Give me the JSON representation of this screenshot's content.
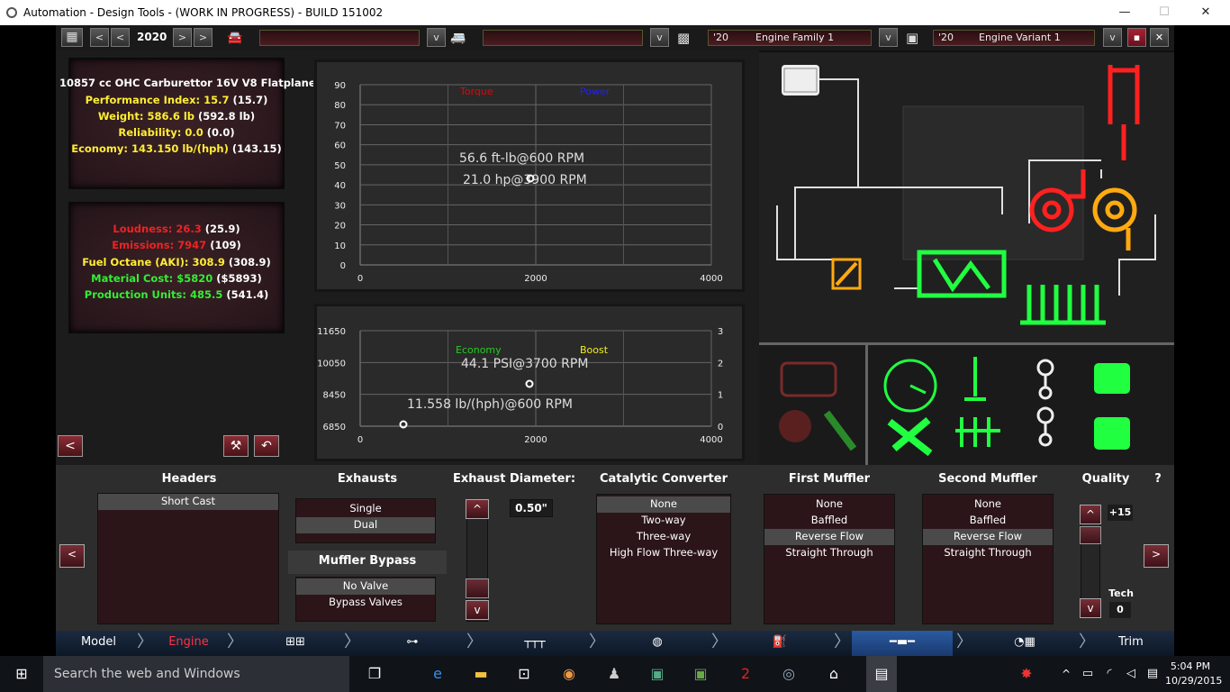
{
  "window": {
    "title": "Automation - Design Tools - (WORK IN PROGRESS) - BUILD 151002",
    "minimize": "—",
    "maximize": "☐",
    "close": "✕"
  },
  "toolbar": {
    "year": "2020",
    "prev": "<",
    "prev2": "<",
    "next": ">",
    "next2": ">",
    "field1": "",
    "field2": "",
    "family_year": "'20",
    "family": "Engine Family 1",
    "variant_year": "'20",
    "variant": "Engine Variant 1",
    "dropdown": "v"
  },
  "stats": {
    "engine": "10857 cc OHC Carburettor 16V V8 Flatplane",
    "perf_label": "Performance Index: 15.7",
    "perf_ref": "(15.7)",
    "weight_label": "Weight: 586.6 lb",
    "weight_ref": "(592.8 lb)",
    "rel_label": "Reliability: 0.0",
    "rel_ref": "(0.0)",
    "eco_label": "Economy: 143.150 lb/(hph)",
    "eco_ref": "(143.15)",
    "loud_label": "Loudness: 26.3",
    "loud_ref": "(25.9)",
    "emis_label": "Emissions: 7947",
    "emis_ref": "(109)",
    "oct_label": "Fuel Octane (AKI): 308.9",
    "oct_ref": "(308.9)",
    "mat_label": "Material Cost: $5820",
    "mat_ref": "($5893)",
    "prod_label": "Production Units: 485.5",
    "prod_ref": "(541.4)"
  },
  "chart_data": [
    {
      "type": "line",
      "legend": [
        "Torque",
        "Power"
      ],
      "colors": [
        "#ee0000",
        "#2222ee"
      ],
      "yticks": [
        "90",
        "80",
        "70",
        "60",
        "50",
        "40",
        "30",
        "20",
        "10",
        "0"
      ],
      "xticks": [
        "0",
        "2000",
        "4000"
      ],
      "ylim": [
        0,
        90
      ],
      "xlim": [
        0,
        4000
      ],
      "series": [
        {
          "name": "Torque",
          "values": []
        },
        {
          "name": "Power",
          "values": []
        }
      ],
      "annotations": [
        "56.6 ft-lb@600 RPM",
        "21.0 hp@3900 RPM"
      ]
    },
    {
      "type": "line",
      "legend": [
        "Economy",
        "Boost"
      ],
      "colors": [
        "#22cc22",
        "#eeee22"
      ],
      "yticks_left": [
        "11650",
        "10050",
        "8450",
        "6850"
      ],
      "yticks_right": [
        "3",
        "2",
        "1",
        "0"
      ],
      "xticks": [
        "0",
        "2000",
        "4000"
      ],
      "ylim": [
        6850,
        11650
      ],
      "ylim_right": [
        0,
        3
      ],
      "xlim": [
        0,
        4000
      ],
      "series": [
        {
          "name": "Economy",
          "values": []
        },
        {
          "name": "Boost",
          "values": []
        }
      ],
      "annotations": [
        "44.1 PSI@3700 RPM",
        "11.558 lb/(hph)@600 RPM"
      ]
    }
  ],
  "panels": {
    "headers": {
      "title": "Headers",
      "options": [
        "Short Cast"
      ]
    },
    "exhausts": {
      "title": "Exhausts",
      "options": [
        "Single",
        "Dual"
      ],
      "bypass_title": "Muffler Bypass",
      "bypass_options": [
        "No Valve",
        "Bypass Valves"
      ]
    },
    "diameter": {
      "title": "Exhaust Diameter:",
      "value": "0.50\""
    },
    "cat": {
      "title": "Catalytic Converter",
      "options": [
        "None",
        "Two-way",
        "Three-way",
        "High Flow Three-way"
      ]
    },
    "muffler1": {
      "title": "First Muffler",
      "options": [
        "None",
        "Baffled",
        "Reverse Flow",
        "Straight Through"
      ]
    },
    "muffler2": {
      "title": "Second Muffler",
      "options": [
        "None",
        "Baffled",
        "Reverse Flow",
        "Straight Through"
      ]
    },
    "quality": {
      "title": "Quality",
      "help": "?",
      "value": "+15",
      "tech_label": "Tech",
      "tech_value": "0"
    }
  },
  "nav": {
    "items": [
      "Model",
      "Engine",
      "",
      "",
      "",
      "",
      "",
      "",
      "",
      "Trim"
    ]
  },
  "taskbar": {
    "search": "Search the web and Windows",
    "time": "5:04 PM",
    "date": "10/29/2015"
  }
}
